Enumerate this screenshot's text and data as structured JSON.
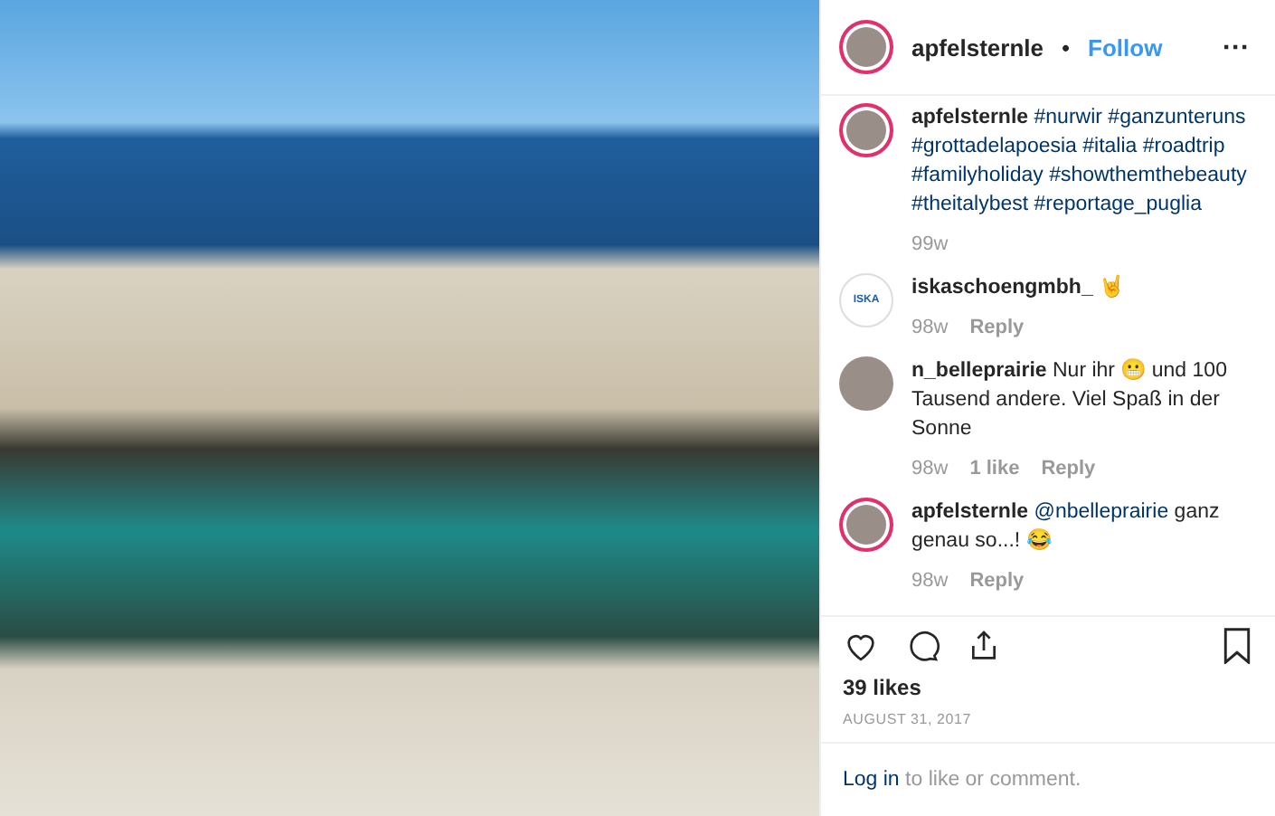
{
  "post": {
    "username": "apfelsternle",
    "story_ring": true,
    "separator": "•",
    "follow": "Follow",
    "more": "···"
  },
  "comments": [
    {
      "kind": "caption",
      "story_ring": true,
      "username": "apfelsternle",
      "text": "#nurwir #ganzunteruns #grottadelapoesia #italia #roadtrip #familyholiday #showthemthebeauty #theitalybest #reportage_puglia",
      "time": "99w"
    },
    {
      "kind": "comment",
      "story_ring": false,
      "avatar_text": "ISKA",
      "username": "iskaschoengmbh_",
      "text": "🤘",
      "time": "98w",
      "reply": "Reply"
    },
    {
      "kind": "comment",
      "story_ring": false,
      "username": "n_belleprairie",
      "text": "Nur ihr 😬 und 100 Tausend andere. Viel Spaß in der Sonne",
      "time": "98w",
      "likes": "1 like",
      "reply": "Reply"
    },
    {
      "kind": "comment",
      "story_ring": true,
      "username": "apfelsternle",
      "mention": "@nbelleprairie",
      "text": "ganz genau so...! 😂",
      "time": "98w",
      "reply": "Reply"
    }
  ],
  "likes": "39 likes",
  "date": "AUGUST 31, 2017",
  "login": {
    "link": "Log in",
    "text": "to like or comment."
  }
}
